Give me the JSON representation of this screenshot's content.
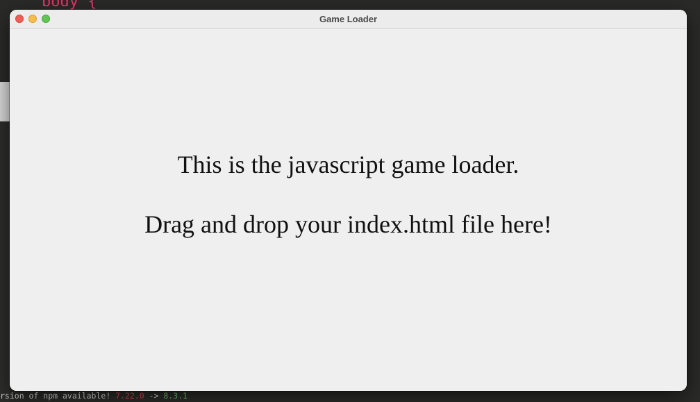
{
  "window": {
    "title": "Game Loader"
  },
  "content": {
    "line1": "This is the javascript game loader.",
    "line2": "Drag and drop your index.html file here!"
  },
  "background": {
    "editor_code": "body {",
    "terminal_notice_prefix": "rsion of npm available! ",
    "terminal_version_old": "7.22.0",
    "terminal_arrow": " -> ",
    "terminal_version_new": "8.3.1"
  },
  "colors": {
    "window_bg": "#efefef",
    "titlebar_bg": "#ececec",
    "close": "#ee5f57",
    "minimize": "#f5bd4f",
    "maximize": "#61c454",
    "text": "#111111"
  },
  "icons": {
    "close": "close-icon",
    "minimize": "minimize-icon",
    "maximize": "maximize-icon"
  }
}
